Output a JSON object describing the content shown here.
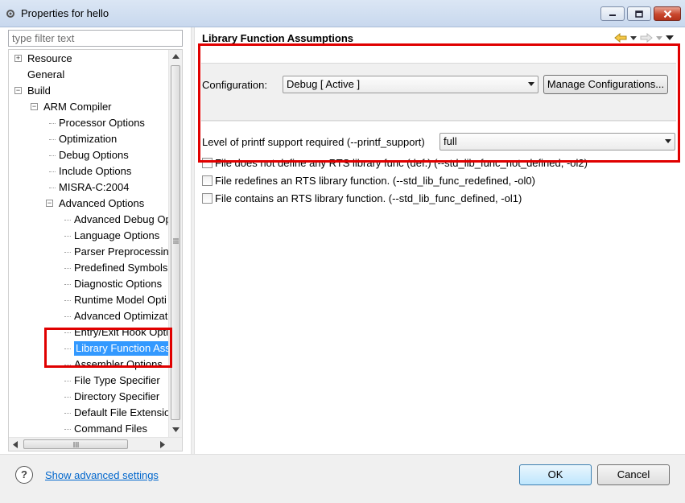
{
  "window": {
    "title": "Properties for hello"
  },
  "filter": {
    "placeholder": "type filter text"
  },
  "tree": {
    "items": [
      {
        "label": "Resource",
        "level": 0,
        "expander": "+"
      },
      {
        "label": "General",
        "level": 0
      },
      {
        "label": "Build",
        "level": 0,
        "expander": "-"
      },
      {
        "label": "ARM Compiler",
        "level": 1,
        "expander": "-"
      },
      {
        "label": "Processor Options",
        "level": 2
      },
      {
        "label": "Optimization",
        "level": 2
      },
      {
        "label": "Debug Options",
        "level": 2
      },
      {
        "label": "Include Options",
        "level": 2
      },
      {
        "label": "MISRA-C:2004",
        "level": 2
      },
      {
        "label": "Advanced Options",
        "level": 2,
        "expander": "-"
      },
      {
        "label": "Advanced Debug Op",
        "level": 3
      },
      {
        "label": "Language Options",
        "level": 3
      },
      {
        "label": "Parser Preprocessin",
        "level": 3
      },
      {
        "label": "Predefined Symbols",
        "level": 3
      },
      {
        "label": "Diagnostic Options",
        "level": 3
      },
      {
        "label": "Runtime Model Opti",
        "level": 3
      },
      {
        "label": "Advanced Optimizat",
        "level": 3
      },
      {
        "label": "Entry/Exit Hook Opti",
        "level": 3
      },
      {
        "label": "Library Function Assu",
        "level": 3,
        "selected": true
      },
      {
        "label": "Assembler Options",
        "level": 3
      },
      {
        "label": "File Type Specifier",
        "level": 3
      },
      {
        "label": "Directory Specifier",
        "level": 3
      },
      {
        "label": "Default File Extensio",
        "level": 3
      },
      {
        "label": "Command Files",
        "level": 3
      }
    ]
  },
  "page": {
    "title": "Library Function Assumptions"
  },
  "configuration": {
    "label": "Configuration:",
    "value": "Debug  [ Active ]",
    "manage_button": "Manage Configurations..."
  },
  "printf": {
    "label": "Level of printf support required (--printf_support)",
    "value": "full"
  },
  "checkboxes": [
    {
      "label": "File does not define any RTS library func (def.) (--std_lib_func_not_defined, -ol2)",
      "checked": false
    },
    {
      "label": "File redefines an RTS library function. (--std_lib_func_redefined, -ol0)",
      "checked": false
    },
    {
      "label": "File contains an RTS library function. (--std_lib_func_defined, -ol1)",
      "checked": false
    }
  ],
  "footer": {
    "advanced_link": "Show advanced settings",
    "ok": "OK",
    "cancel": "Cancel"
  },
  "colors": {
    "highlight": "#e00000",
    "selection": "#3399ff",
    "link": "#0066cc"
  }
}
